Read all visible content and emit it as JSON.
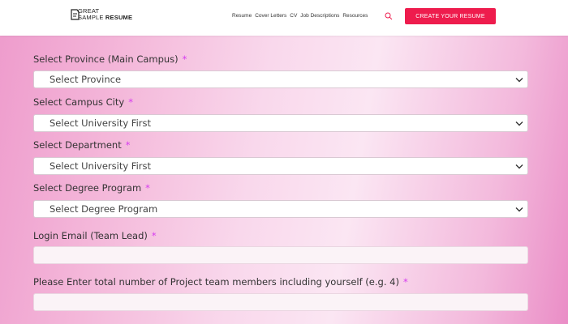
{
  "header": {
    "logo_line1": "GREAT",
    "logo_line2_a": "SAMPLE ",
    "logo_line2_b": "RESUME",
    "nav_items": [
      "Resume",
      "Cover Letters",
      "CV",
      "Job Descriptions",
      "Resources"
    ],
    "cta_label": "CREATE YOUR RESUME",
    "cta_color": "#ee1c4d"
  },
  "form": {
    "province": {
      "label": "Select Province (Main Campus)",
      "required": "*",
      "value": "Select Province"
    },
    "campus_city": {
      "label": "Select Campus City",
      "required": "*",
      "value": "Select University First"
    },
    "department": {
      "label": "Select Department",
      "required": "*",
      "value": "Select University First"
    },
    "degree_program": {
      "label": "Select Degree Program",
      "required": "*",
      "value": "Select Degree Program"
    },
    "login_email": {
      "label": "Login Email (Team Lead)",
      "required": "*",
      "value": ""
    },
    "team_members": {
      "label": "Please Enter total number of Project team members including yourself (e.g. 4)",
      "required": "*",
      "value": ""
    }
  },
  "colors": {
    "required_mark": "#d63af0"
  }
}
